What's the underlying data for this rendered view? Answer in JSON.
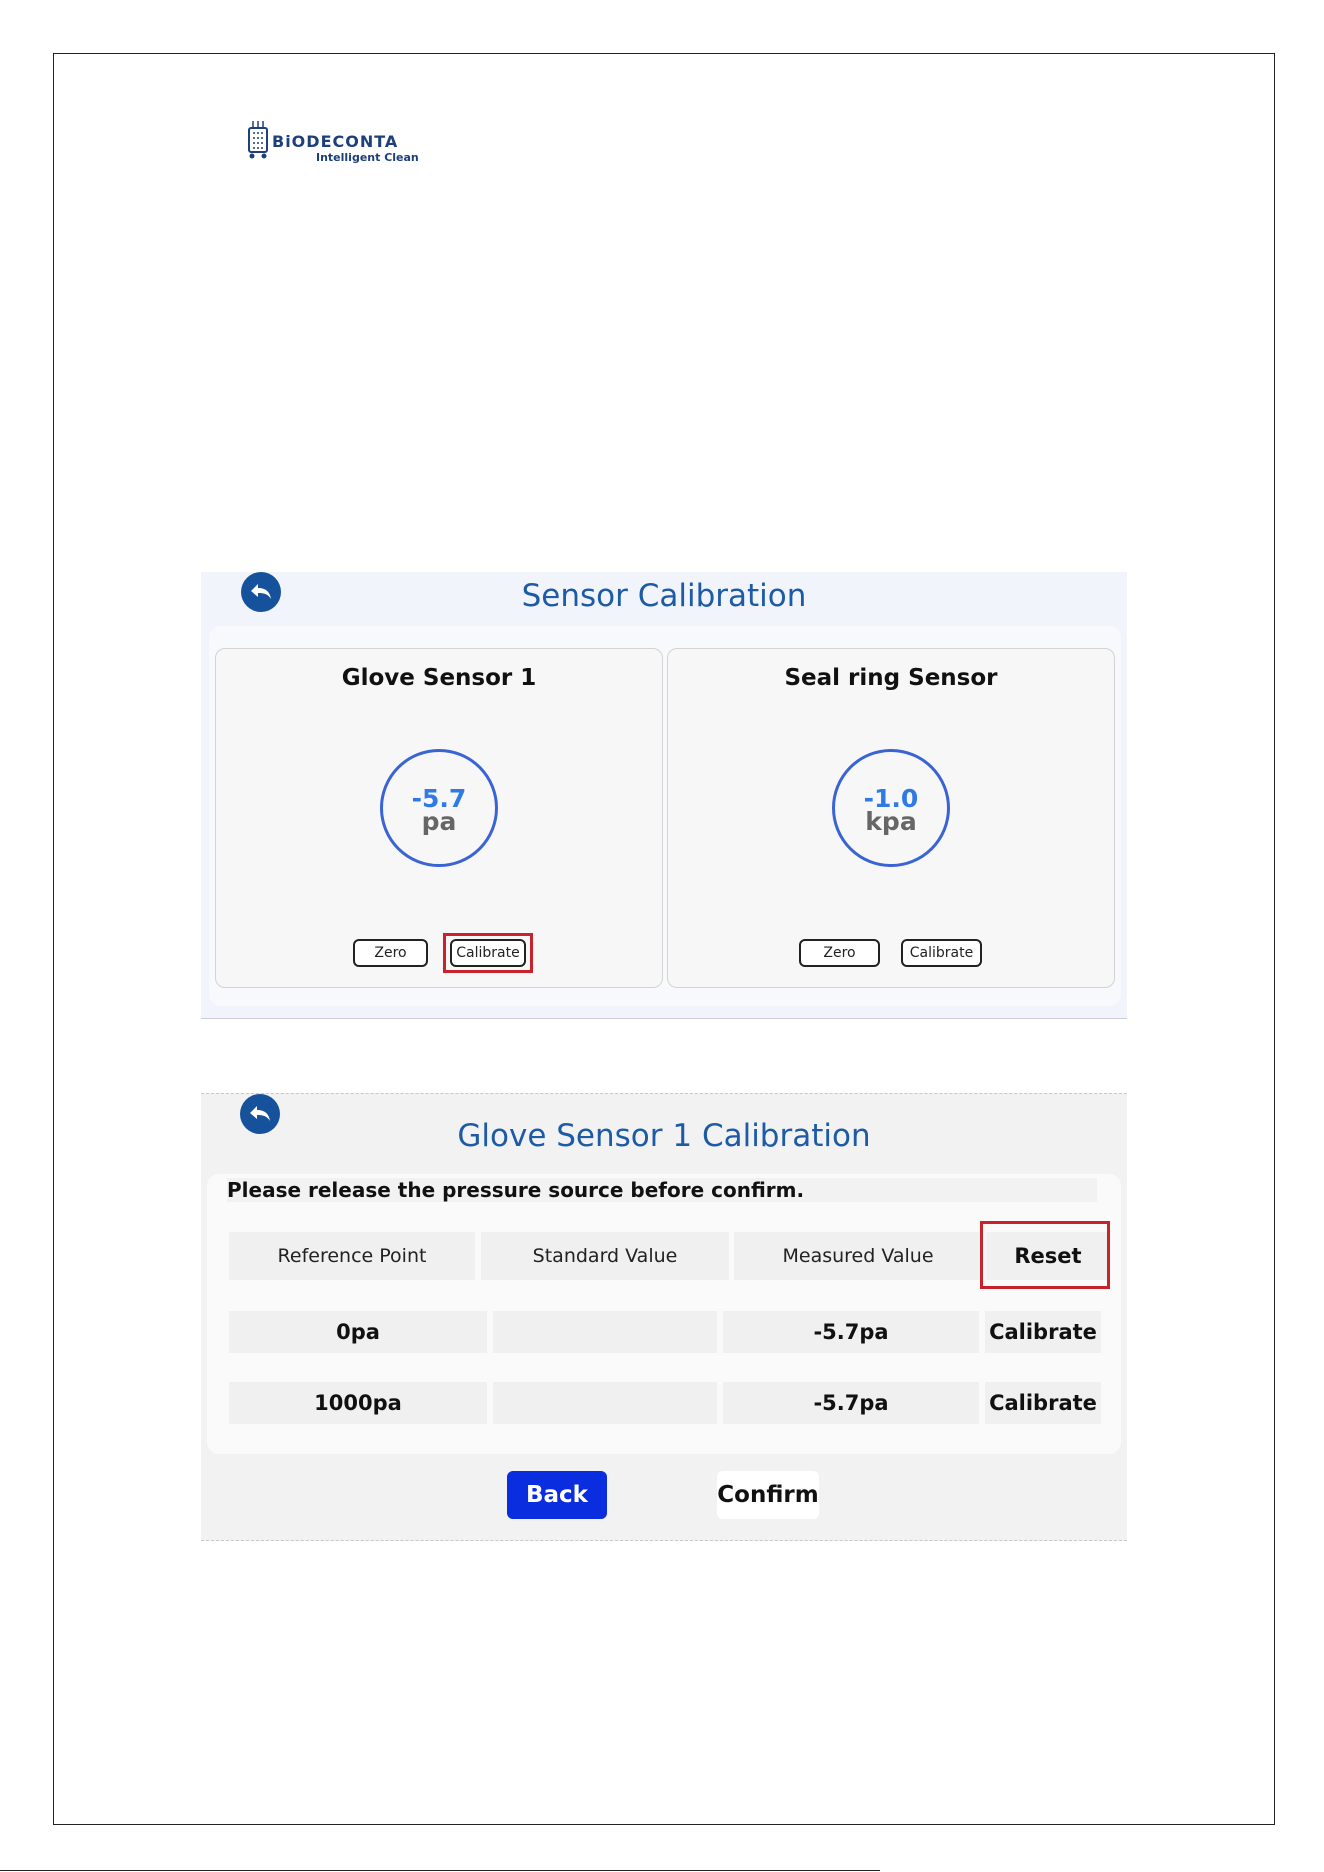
{
  "logo": {
    "brand": "BiODECONTA",
    "tagline": "Intelligent Clean"
  },
  "sensor_screen": {
    "title": "Sensor Calibration",
    "sensors": [
      {
        "name": "Glove Sensor 1",
        "value": "-5.7",
        "unit": "pa",
        "zero_label": "Zero",
        "calibrate_label": "Calibrate"
      },
      {
        "name": "Seal ring Sensor",
        "value": "-1.0",
        "unit": "kpa",
        "zero_label": "Zero",
        "calibrate_label": "Calibrate"
      }
    ]
  },
  "calibration_screen": {
    "title": "Glove Sensor 1 Calibration",
    "notice": "Please release the pressure source before confirm.",
    "headers": [
      "Reference Point",
      "Standard Value",
      "Measured Value"
    ],
    "reset_label": "Reset",
    "rows": [
      {
        "reference": "0pa",
        "standard": "",
        "measured": "-5.7pa",
        "action": "Calibrate"
      },
      {
        "reference": "1000pa",
        "standard": "",
        "measured": "-5.7pa",
        "action": "Calibrate"
      }
    ],
    "back_label": "Back",
    "confirm_label": "Confirm"
  },
  "colors": {
    "accent_blue": "#1d5ba6",
    "back_icon_blue": "#16529b",
    "gauge_ring": "#3a63d4",
    "gauge_value": "#2f7ae5",
    "highlight_red": "#c8232c",
    "back_button": "#0b2de0"
  }
}
